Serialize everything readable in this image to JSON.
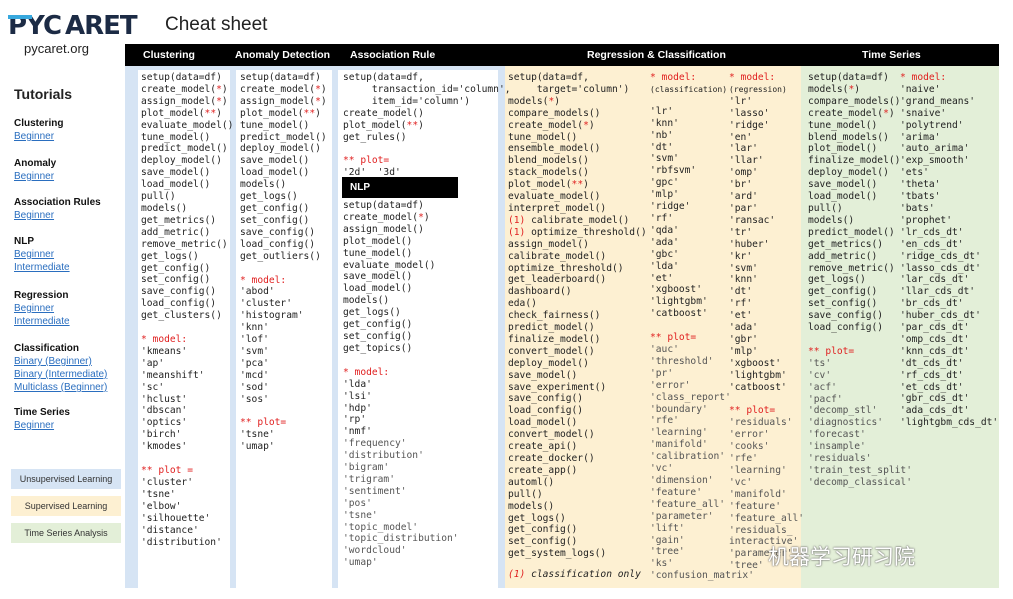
{
  "header": {
    "logo_text": "PYCARET",
    "title": "Cheat sheet",
    "site": "pycaret.org"
  },
  "sidebar": {
    "heading": "Tutorials",
    "sections": [
      {
        "title": "Clustering",
        "links": [
          "Beginner"
        ]
      },
      {
        "title": "Anomaly",
        "links": [
          "Beginner"
        ]
      },
      {
        "title": "Association Rules",
        "links": [
          "Beginner"
        ]
      },
      {
        "title": "NLP",
        "links": [
          "Beginner",
          "Intermediate"
        ]
      },
      {
        "title": "Regression",
        "links": [
          "Beginner",
          "Intermediate"
        ]
      },
      {
        "title": "Classification",
        "links": [
          "Binary (Beginner)",
          "Binary (Intermediate)",
          "Multiclass (Beginner)"
        ]
      },
      {
        "title": "Time Series",
        "links": [
          "Beginner"
        ]
      }
    ],
    "legend": [
      {
        "label": "Unsupervised Learning",
        "color": "#d6e4f4"
      },
      {
        "label": "Supervised Learning",
        "color": "#fdf0d2"
      },
      {
        "label": "Time Series Analysis",
        "color": "#e3efd8"
      }
    ]
  },
  "colors": {
    "unsupervised": "#d6e4f4",
    "supervised": "#fdf0d2",
    "time_series": "#e3efd8",
    "required": "#e02020"
  },
  "headers": {
    "clustering": "Clustering",
    "anomaly": "Anomaly Detection",
    "association": "Association Rule",
    "regclass": "Regression & Classification",
    "timeseries": "Time Series"
  },
  "nlp_label": "NLP",
  "watermark": "机器学习研习院",
  "clustering": {
    "functions": [
      "setup(data=df)",
      "create_model(*)",
      "assign_model(*)",
      "plot_model(**)",
      "evaluate_model()",
      "tune_model()",
      "predict_model()",
      "deploy_model()",
      "save_model()",
      "load_model()",
      "pull()",
      "models()",
      "get_metrics()",
      "add_metric()",
      "remove_metric()",
      "get_logs()",
      "get_config()",
      "set_config()",
      "save_config()",
      "load_config()",
      "get_clusters()"
    ],
    "model_head": "* model:",
    "models": [
      "'kmeans'",
      "'ap'",
      "'meanshift'",
      "'sc'",
      "'hclust'",
      "'dbscan'",
      "'optics'",
      "'birch'",
      "'kmodes'"
    ],
    "plot_head": "** plot =",
    "plots": [
      "'cluster'",
      "'tsne'",
      "'elbow'",
      "'silhouette'",
      "'distance'",
      "'distribution'"
    ]
  },
  "anomaly": {
    "functions": [
      "setup(data=df)",
      "create_model(*)",
      "assign_model(*)",
      "plot_model(**)",
      "tune_model()",
      "predict_model()",
      "deploy_model()",
      "save_model()",
      "load_model()",
      "models()",
      "get_logs()",
      "get_config()",
      "set_config()",
      "save_config()",
      "load_config()",
      "get_outliers()"
    ],
    "model_head": "* model:",
    "models": [
      "'abod'",
      "'cluster'",
      "'histogram'",
      "'knn'",
      "'lof'",
      "'svm'",
      "'pca'",
      "'mcd'",
      "'sod'",
      "'sos'"
    ],
    "plot_head": "** plot=",
    "plots": [
      "'tsne'",
      "'umap'"
    ]
  },
  "association": {
    "functions": [
      "setup(data=df,",
      "     transaction_id='column',",
      "     item_id='column')",
      "create_model()",
      "plot_model(**)",
      "get_rules()"
    ],
    "plot_head": "** plot=",
    "plots": "'2d'  '3d'"
  },
  "nlp": {
    "functions": [
      "setup(data=df)",
      "create_model(*)",
      "assign_model()",
      "plot_model()",
      "tune_model()",
      "evaluate_model()",
      "save_model()",
      "load_model()",
      "models()",
      "get_logs()",
      "get_config()",
      "set_config()",
      "get_topics()"
    ],
    "model_head": "* model:",
    "models": [
      "'lda'",
      "'lsi'",
      "'hdp'",
      "'rp'",
      "'nmf'"
    ],
    "plots": [
      "'frequency'",
      "'distribution'",
      "'bigram'",
      "'trigram'",
      "'sentiment'",
      "'pos'",
      "'tsne'",
      "'topic_model'",
      "'topic_distribution'",
      "'wordcloud'",
      "'umap'"
    ]
  },
  "regclass": {
    "functions": [
      "setup(data=df,",
      "     target='column')",
      "models(*)",
      "compare_models()",
      "create_model(*)",
      "tune_model()",
      "ensemble_model()",
      "blend_models()",
      "stack_models()",
      "plot_model(**)",
      "evaluate_model()",
      "interpret_model()",
      "(1) calibrate_model()",
      "(1) optimize_threshold()",
      "assign_model()",
      "calibrate_model()",
      "optimize_threshold()",
      "get_leaderboard()",
      "dashboard()",
      "eda()",
      "check_fairness()",
      "predict_model()",
      "finalize_model()",
      "convert_model()",
      "deploy_model()",
      "save_model()",
      "save_experiment()",
      "save_config()",
      "load_config()",
      "load_model()",
      "convert_model()",
      "create_api()",
      "create_docker()",
      "create_app()",
      "automl()",
      "pull()",
      "models()",
      "get_logs()",
      "get_config()",
      "set_config()",
      "get_system_logs()"
    ],
    "footnote": "(1) classification only",
    "class_model_head": "* model:",
    "class_model_sub": "(classification)",
    "class_models": [
      "'lr'",
      "'knn'",
      "'nb'",
      "'dt'",
      "'svm'",
      "'rbfsvm'",
      "'gpc'",
      "'mlp'",
      "'ridge'",
      "'rf'",
      "'qda'",
      "'ada'",
      "'gbc'",
      "'lda'",
      "'et'",
      "'xgboost'",
      "'lightgbm'",
      "'catboost'"
    ],
    "class_plot_head": "** plot=",
    "class_plots": [
      "'auc'",
      "'threshold'",
      "'pr'",
      "'error'",
      "'class_report'",
      "'boundary'",
      "'rfe'",
      "'learning'",
      "'manifold'",
      "'calibration'",
      "'vc'",
      "'dimension'",
      "'feature'",
      "'feature_all'",
      "'parameter'",
      "'lift'",
      "'gain'",
      "'tree'",
      "'ks'",
      "'confusion_matrix'"
    ],
    "reg_model_head": "* model:",
    "reg_model_sub": "(regression)",
    "reg_models": [
      "'lr'",
      "'lasso'",
      "'ridge'",
      "'en'",
      "'lar'",
      "'llar'",
      "'omp'",
      "'br'",
      "'ard'",
      "'par'",
      "'ransac'",
      "'tr'",
      "'huber'",
      "'kr'",
      "'svm'",
      "'knn'",
      "'dt'",
      "'rf'",
      "'et'",
      "'ada'",
      "'gbr'",
      "'mlp'",
      "'xgboost'",
      "'lightgbm'",
      "'catboost'"
    ],
    "reg_plot_head": "** plot=",
    "reg_plots": [
      "'residuals'",
      "'error'",
      "'cooks'",
      "'rfe'",
      "'learning'",
      "'vc'",
      "'manifold'",
      "'feature'",
      "'feature_all'",
      "'residuals_",
      "interactive'",
      "'parameter'",
      "'tree'"
    ]
  },
  "timeseries": {
    "functions": [
      "setup(data=df)",
      "models(*)",
      "compare_models()",
      "create_model(*)",
      "tune_model()",
      "blend_models()",
      "plot_model()",
      "finalize_model()",
      "deploy_model()",
      "save_model()",
      "load_model()",
      "pull()",
      "models()",
      "predict_model()",
      "get_metrics()",
      "add_metric()",
      "remove_metric()",
      "get_logs()",
      "get_config()",
      "set_config()",
      "save_config()",
      "load_config()"
    ],
    "model_head": "* model:",
    "models": [
      "'naive'",
      "'grand_means'",
      "'snaive'",
      "'polytrend'",
      "'arima'",
      "'auto_arima'",
      "'exp_smooth'",
      "'ets'",
      "'theta'",
      "'tbats'",
      "'bats'",
      "'prophet'",
      "'lr_cds_dt'",
      "'en_cds_dt'",
      "'ridge_cds_dt'",
      "'lasso_cds_dt'",
      "'lar_cds_dt'",
      "'llar_cds_dt'",
      "'br_cds_dt'",
      "'huber_cds_dt'",
      "'par_cds_dt'",
      "'omp_cds_dt'",
      "'knn_cds_dt'",
      "'dt_cds_dt'",
      "'rf_cds_dt'",
      "'et_cds_dt'",
      "'gbr_cds_dt'",
      "'ada_cds_dt'",
      "'lightgbm_cds_dt'"
    ],
    "plot_head": "** plot=",
    "plots": [
      "'ts'",
      "'cv'",
      "'acf'",
      "'pacf'",
      "'decomp_stl'",
      "'diagnostics'",
      "'forecast'",
      "'insample'",
      "'residuals'",
      "'train_test_split'",
      "'decomp_classical'"
    ]
  }
}
